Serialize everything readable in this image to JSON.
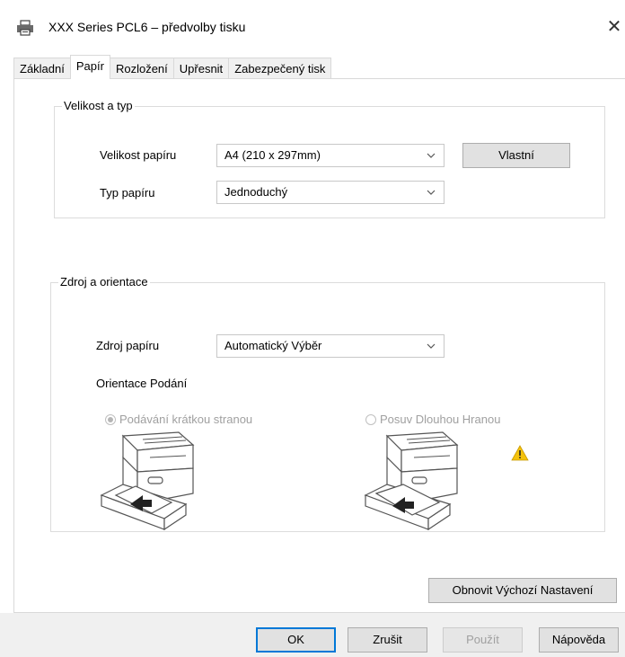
{
  "window": {
    "title": "XXX Series PCL6 – předvolby tisku",
    "close_symbol": "✕"
  },
  "tabs": [
    {
      "label": "Základní",
      "active": false
    },
    {
      "label": "Papír",
      "active": true
    },
    {
      "label": "Rozložení",
      "active": false
    },
    {
      "label": "Upřesnit",
      "active": false
    },
    {
      "label": "Zabezpečený tisk",
      "active": false
    }
  ],
  "size_group": {
    "legend": "Velikost a typ",
    "paper_size_label": "Velikost papíru",
    "paper_size_value": "A4 (210 x 297mm)",
    "custom_button": "Vlastní",
    "paper_type_label": "Typ papíru",
    "paper_type_value": "Jednoduchý"
  },
  "source_group": {
    "legend": "Zdroj a orientace",
    "paper_source_label": "Zdroj papíru",
    "paper_source_value": "Automatický Výběr",
    "feed_orientation_label": "Orientace Podání",
    "short_edge_label": "Podávání krátkou stranou",
    "short_edge_selected": true,
    "long_edge_label": "Posuv Dlouhou Hranou",
    "long_edge_selected": false,
    "warning_icon": "warning-icon"
  },
  "restore_defaults_button": "Obnovit Výchozí Nastavení",
  "footer": {
    "ok": "OK",
    "cancel": "Zrušit",
    "apply": "Použít",
    "help": "Nápověda"
  },
  "colors": {
    "focus_border": "#0078d7",
    "warning_yellow": "#f4c20d"
  }
}
